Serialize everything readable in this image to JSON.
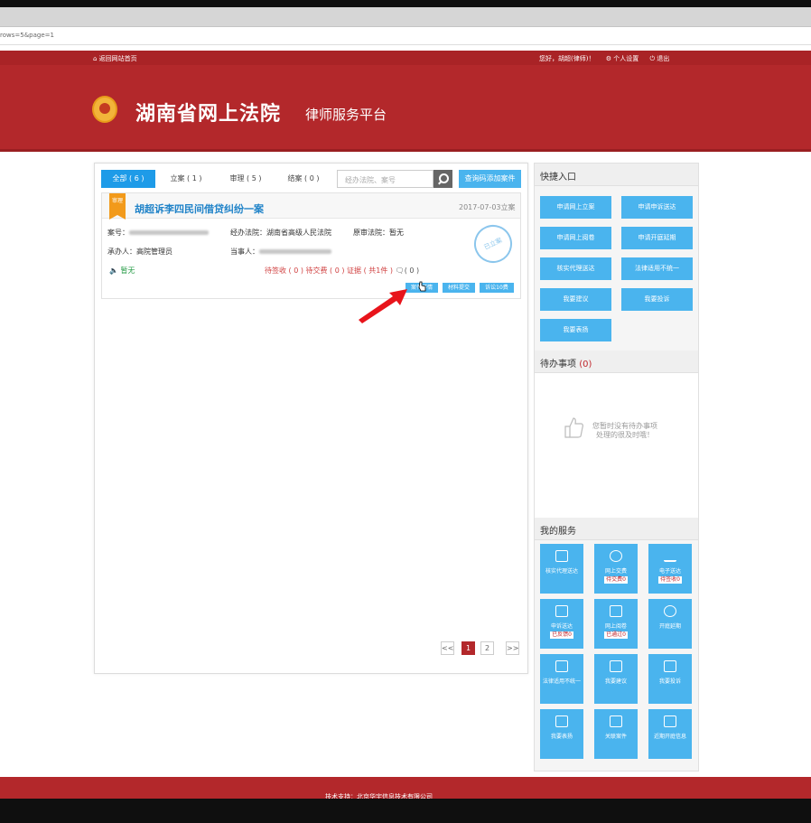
{
  "browser": {
    "address_text": "rows=5&page=1"
  },
  "header": {
    "home_link": "⌂ 返回网站首页",
    "greeting": "您好，胡超(律师)！",
    "settings": "⚙ 个人设置",
    "logout": "⏻ 退出",
    "title": "湖南省网上法院",
    "subtitle": "律师服务平台"
  },
  "tabs": [
    {
      "label": "全部 ( 6 )"
    },
    {
      "label": "立案 ( 1 )"
    },
    {
      "label": "审理 ( 5 )"
    },
    {
      "label": "结案 ( 0 )"
    }
  ],
  "search": {
    "placeholder": "经办法院、案号",
    "query_button": "查询码添加案件"
  },
  "case": {
    "flag": "审理",
    "title": "胡超诉李四民间借贷纠纷一案",
    "date": "2017-07-03立案",
    "case_no_label": "案号：",
    "court_label": "经办法院：湖南省高级人民法院",
    "orig_court_label": "原审法院：暂无",
    "clerk_label": "承办人：高院管理员",
    "party_label": "当事人：",
    "tempty": "暂无",
    "stamp": "已立案",
    "status_sign": "待签收 ( 0 )",
    "status_pay": "待交费 ( 0 )",
    "status_evidence": "证据 ( 共1件 )",
    "status_msg": "( 0 )",
    "actions": [
      "案件详情",
      "材料提交",
      "诉讼10费"
    ]
  },
  "pagination": {
    "prev": "<<",
    "pages": [
      "1",
      "2"
    ],
    "next": ">>"
  },
  "quick": {
    "title": "快捷入口",
    "buttons": [
      "申请网上立案",
      "申请申诉送达",
      "申请网上阅卷",
      "申请开庭延期",
      "核实代理送达",
      "法律适用不统一",
      "我要建议",
      "我要投诉",
      "我要表扬"
    ]
  },
  "todo": {
    "title": "待办事项",
    "count": "(0)",
    "line1": "您暂时没有待办事项",
    "line2": "处理的很及时哦！"
  },
  "services": {
    "title": "我的服务",
    "tiles": [
      {
        "label": "核实代理送达",
        "badge": ""
      },
      {
        "label": "网上交费",
        "badge": "待交费0"
      },
      {
        "label": "电子送达",
        "badge": "待签收0"
      },
      {
        "label": "申诉送达",
        "badge": "已反馈0"
      },
      {
        "label": "网上阅卷",
        "badge": "已通过0"
      },
      {
        "label": "开庭延期",
        "badge": ""
      },
      {
        "label": "法律适用不统一",
        "badge": ""
      },
      {
        "label": "我要建议",
        "badge": ""
      },
      {
        "label": "我要投诉",
        "badge": ""
      },
      {
        "label": "我要表扬",
        "badge": ""
      },
      {
        "label": "关联案件",
        "badge": ""
      },
      {
        "label": "近期开庭信息",
        "badge": ""
      }
    ]
  },
  "footer": {
    "text": "技术支持：北京华宇信息技术有限公司"
  },
  "colors": {
    "brand_red": "#b3282b",
    "accent_blue": "#4ab4ee",
    "tab_active": "#1e9be8"
  }
}
